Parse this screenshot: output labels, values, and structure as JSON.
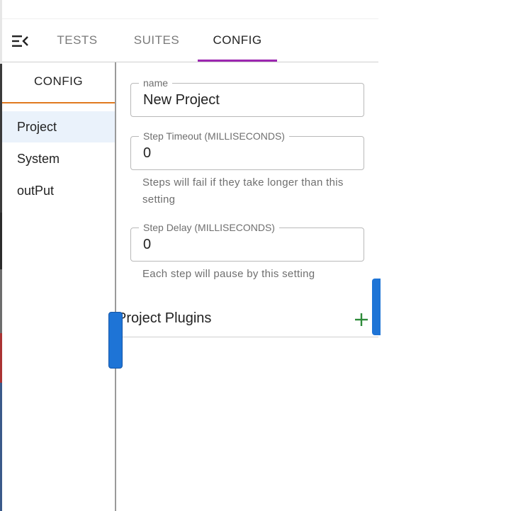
{
  "tabs": [
    {
      "label": "TESTS"
    },
    {
      "label": "SUITES"
    },
    {
      "label": "CONFIG",
      "active": true
    }
  ],
  "sidebar": {
    "title": "CONFIG",
    "items": [
      {
        "label": "Project",
        "selected": true
      },
      {
        "label": "System"
      },
      {
        "label": "outPut"
      }
    ]
  },
  "fields": {
    "name": {
      "label": "name",
      "value": "New Project"
    },
    "step_timeout": {
      "label": "Step Timeout (MILLISECONDS)",
      "value": "0",
      "helper": "Steps will fail if they take longer than this setting"
    },
    "step_delay": {
      "label": "Step Delay (MILLISECONDS)",
      "value": "0",
      "helper": "Each step will pause by this setting"
    }
  },
  "plugins": {
    "title": "Project Plugins"
  },
  "icons": {
    "menu": "menu-collapse-icon",
    "add": "plus-icon"
  },
  "colors": {
    "active_tab_underline": "#9c27b0",
    "sidebar_title_underline": "#e07a1f",
    "selected_item_bg": "#eaf2fb",
    "add_icon": "#2e8b3a",
    "resize_handle": "#1e74d6"
  }
}
